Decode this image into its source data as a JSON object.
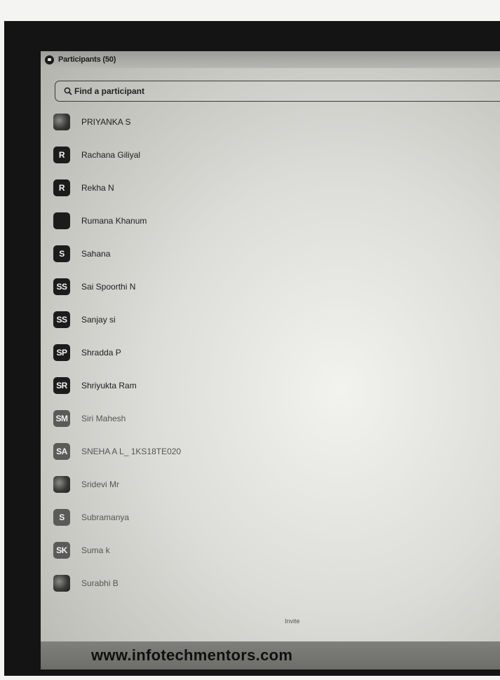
{
  "panel": {
    "title": "Participants (50)"
  },
  "search": {
    "placeholder": "Find a participant"
  },
  "participants": [
    {
      "initials": "",
      "name": "PRIYANKA S",
      "avatar": "photo"
    },
    {
      "initials": "R",
      "name": "Rachana Giliyal",
      "avatar": "initials"
    },
    {
      "initials": "R",
      "name": "Rekha N",
      "avatar": "initials"
    },
    {
      "initials": "",
      "name": "Rumana Khanum",
      "avatar": "blank"
    },
    {
      "initials": "S",
      "name": "Sahana",
      "avatar": "initials"
    },
    {
      "initials": "SS",
      "name": "Sai Spoorthi N",
      "avatar": "initials"
    },
    {
      "initials": "SS",
      "name": "Sanjay si",
      "avatar": "initials"
    },
    {
      "initials": "SP",
      "name": "Shradda P",
      "avatar": "initials"
    },
    {
      "initials": "SR",
      "name": "Shriyukta Ram",
      "avatar": "initials"
    },
    {
      "initials": "SM",
      "name": "Siri Mahesh",
      "avatar": "initials"
    },
    {
      "initials": "SA",
      "name": "SNEHA A L_ 1KS18TE020",
      "avatar": "initials"
    },
    {
      "initials": "",
      "name": "Sridevi Mr",
      "avatar": "photo"
    },
    {
      "initials": "S",
      "name": "Subramanya",
      "avatar": "initials"
    },
    {
      "initials": "SK",
      "name": "Suma k",
      "avatar": "initials"
    },
    {
      "initials": "",
      "name": "Surabhi B",
      "avatar": "photo"
    }
  ],
  "invite": {
    "label": "Invite"
  },
  "watermark": {
    "text": "www.infotechmentors.com"
  }
}
